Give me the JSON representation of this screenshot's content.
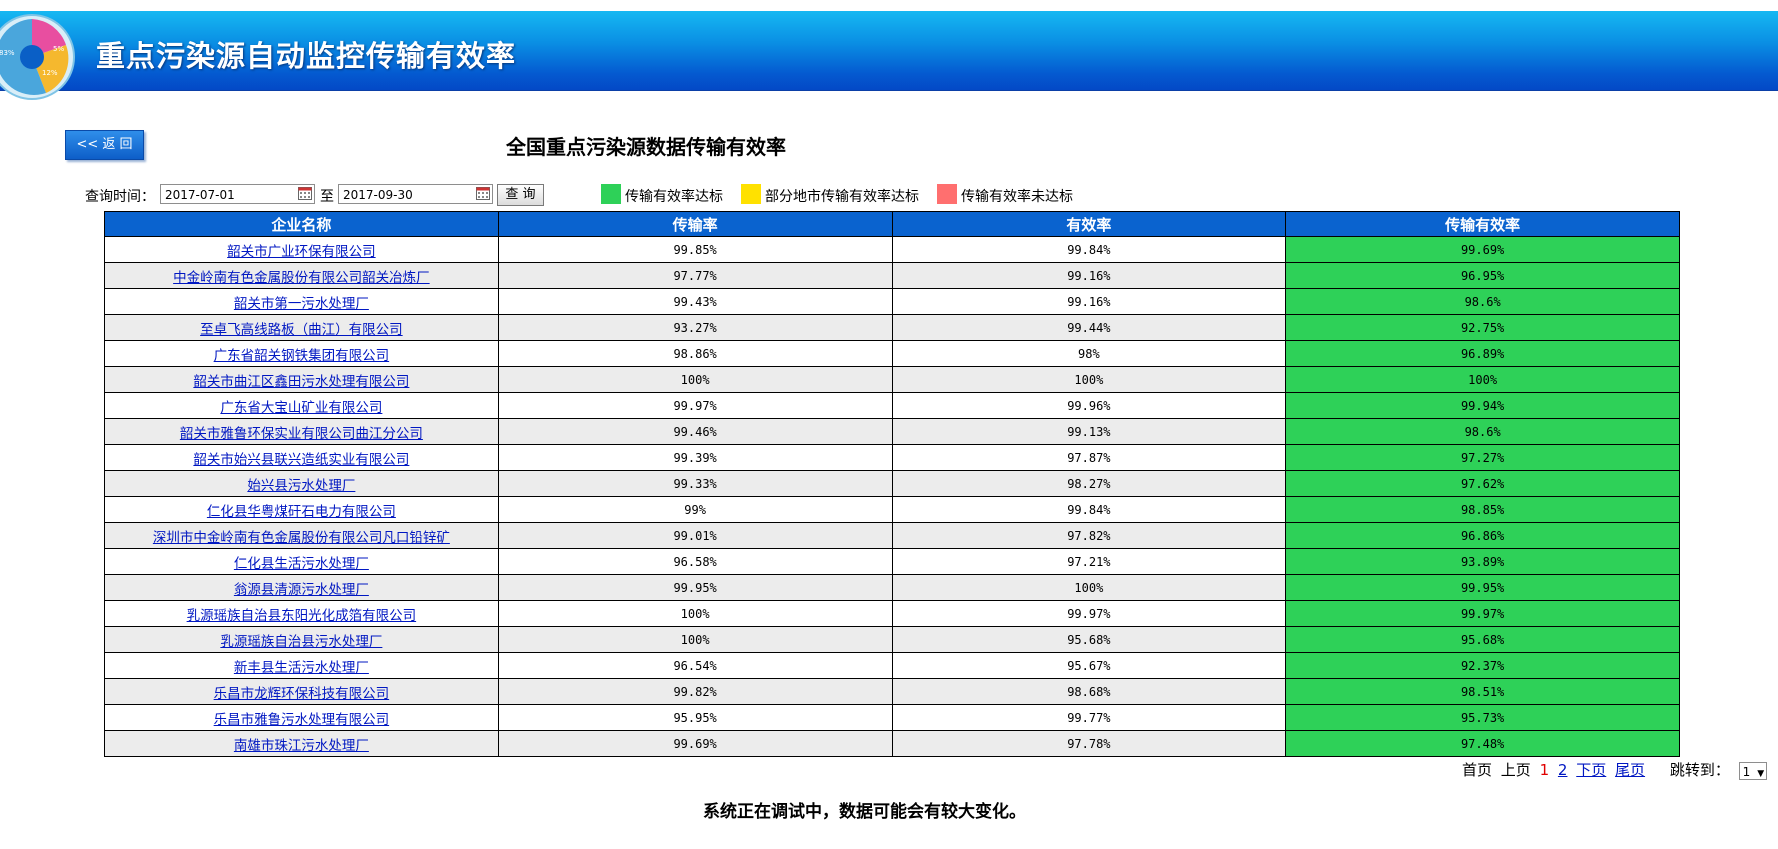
{
  "header": {
    "title": "重点污染源自动监控传输有效率",
    "logo_labels": [
      "83%",
      "5%",
      "12%"
    ]
  },
  "back_button": "<< 返 回",
  "page_title": "全国重点污染源数据传输有效率",
  "query": {
    "label": "查询时间：",
    "start_date": "2017-07-01",
    "to_label": "至",
    "end_date": "2017-09-30",
    "button": "查 询"
  },
  "legend": [
    {
      "label": "传输有效率达标",
      "color": "#2ed158"
    },
    {
      "label": "部分地市传输有效率达标",
      "color": "#ffe100"
    },
    {
      "label": "传输有效率未达标",
      "color": "#ff6f6f"
    }
  ],
  "table": {
    "headers": [
      "企业名称",
      "传输率",
      "有效率",
      "传输有效率"
    ],
    "rows": [
      {
        "name": "韶关市广业环保有限公司",
        "transmission": "99.85%",
        "validity": "99.84%",
        "effective": "99.69%"
      },
      {
        "name": "中金岭南有色金属股份有限公司韶关冶炼厂",
        "transmission": "97.77%",
        "validity": "99.16%",
        "effective": "96.95%"
      },
      {
        "name": "韶关市第一污水处理厂",
        "transmission": "99.43%",
        "validity": "99.16%",
        "effective": "98.6%"
      },
      {
        "name": "至卓飞高线路板（曲江）有限公司",
        "transmission": "93.27%",
        "validity": "99.44%",
        "effective": "92.75%"
      },
      {
        "name": "广东省韶关钢铁集团有限公司",
        "transmission": "98.86%",
        "validity": "98%",
        "effective": "96.89%"
      },
      {
        "name": "韶关市曲江区鑫田污水处理有限公司",
        "transmission": "100%",
        "validity": "100%",
        "effective": "100%"
      },
      {
        "name": "广东省大宝山矿业有限公司",
        "transmission": "99.97%",
        "validity": "99.96%",
        "effective": "99.94%"
      },
      {
        "name": "韶关市雅鲁环保实业有限公司曲江分公司",
        "transmission": "99.46%",
        "validity": "99.13%",
        "effective": "98.6%"
      },
      {
        "name": "韶关市始兴县联兴造纸实业有限公司",
        "transmission": "99.39%",
        "validity": "97.87%",
        "effective": "97.27%"
      },
      {
        "name": "始兴县污水处理厂",
        "transmission": "99.33%",
        "validity": "98.27%",
        "effective": "97.62%"
      },
      {
        "name": "仁化县华粤煤矸石电力有限公司",
        "transmission": "99%",
        "validity": "99.84%",
        "effective": "98.85%"
      },
      {
        "name": "深圳市中金岭南有色金属股份有限公司凡口铅锌矿",
        "transmission": "99.01%",
        "validity": "97.82%",
        "effective": "96.86%"
      },
      {
        "name": "仁化县生活污水处理厂",
        "transmission": "96.58%",
        "validity": "97.21%",
        "effective": "93.89%"
      },
      {
        "name": "翁源县清源污水处理厂",
        "transmission": "99.95%",
        "validity": "100%",
        "effective": "99.95%"
      },
      {
        "name": "乳源瑶族自治县东阳光化成箔有限公司",
        "transmission": "100%",
        "validity": "99.97%",
        "effective": "99.97%"
      },
      {
        "name": "乳源瑶族自治县污水处理厂",
        "transmission": "100%",
        "validity": "95.68%",
        "effective": "95.68%"
      },
      {
        "name": "新丰县生活污水处理厂",
        "transmission": "96.54%",
        "validity": "95.67%",
        "effective": "92.37%"
      },
      {
        "name": "乐昌市龙辉环保科技有限公司",
        "transmission": "99.82%",
        "validity": "98.68%",
        "effective": "98.51%"
      },
      {
        "name": "乐昌市雅鲁污水处理有限公司",
        "transmission": "95.95%",
        "validity": "99.77%",
        "effective": "95.73%"
      },
      {
        "name": "南雄市珠江污水处理厂",
        "transmission": "99.69%",
        "validity": "97.78%",
        "effective": "97.48%"
      }
    ]
  },
  "pagination": {
    "first": "首页",
    "prev": "上页",
    "pages": [
      "1",
      "2"
    ],
    "current": "1",
    "next": "下页",
    "last": "尾页",
    "jump_label": "跳转到：",
    "jump_value": "1"
  },
  "footer_note": "系统正在调试中，数据可能会有较大变化。"
}
